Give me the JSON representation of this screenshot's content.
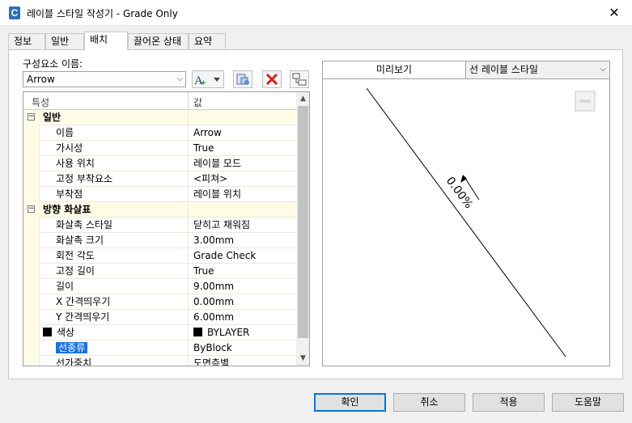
{
  "window": {
    "title": "레이블 스타일 작성기 - Grade Only",
    "close": "✕",
    "app_icon": "C"
  },
  "tabs": [
    "정보",
    "일반",
    "배치",
    "끌어온 상태",
    "요약"
  ],
  "active_tab": 2,
  "component": {
    "label": "구성요소 이름:",
    "value": "Arrow"
  },
  "grid": {
    "headers": {
      "property": "특성",
      "value": "값"
    },
    "groups": [
      {
        "name": "일반",
        "rows": [
          {
            "name": "이름",
            "value": "Arrow"
          },
          {
            "name": "가시성",
            "value": "True"
          },
          {
            "name": "사용 위치",
            "value": "레이블 모드"
          },
          {
            "name": "고정 부착요소",
            "value": "<피쳐>"
          },
          {
            "name": "부착점",
            "value": "레이블 위치"
          }
        ]
      },
      {
        "name": "방향 화살표",
        "rows": [
          {
            "name": "화살촉 스타일",
            "value": "닫히고 채워짐"
          },
          {
            "name": "화살촉 크기",
            "value": "3.00mm"
          },
          {
            "name": "회전 각도",
            "value": "Grade Check"
          },
          {
            "name": "고정 길이",
            "value": "True"
          },
          {
            "name": "길이",
            "value": "9.00mm"
          },
          {
            "name": "X 간격띄우기",
            "value": "0.00mm"
          },
          {
            "name": "Y 간격띄우기",
            "value": "6.00mm"
          },
          {
            "name": "색상",
            "value": "BYLAYER"
          },
          {
            "name": "선종류",
            "value": "ByBlock"
          },
          {
            "name": "선가중치",
            "value": "도면층별"
          }
        ]
      }
    ],
    "selected_row": "선종류"
  },
  "preview": {
    "tab_label": "미리보기",
    "style_select": "선 레이블 스타일",
    "label_text": "0.00%"
  },
  "buttons": {
    "ok": "확인",
    "cancel": "취소",
    "apply": "적용",
    "help": "도움말"
  },
  "colors": {
    "accent": "#0078d7",
    "selection": "#1a73d9",
    "group_bg": "#fffce6",
    "delete_red": "#d42020"
  }
}
